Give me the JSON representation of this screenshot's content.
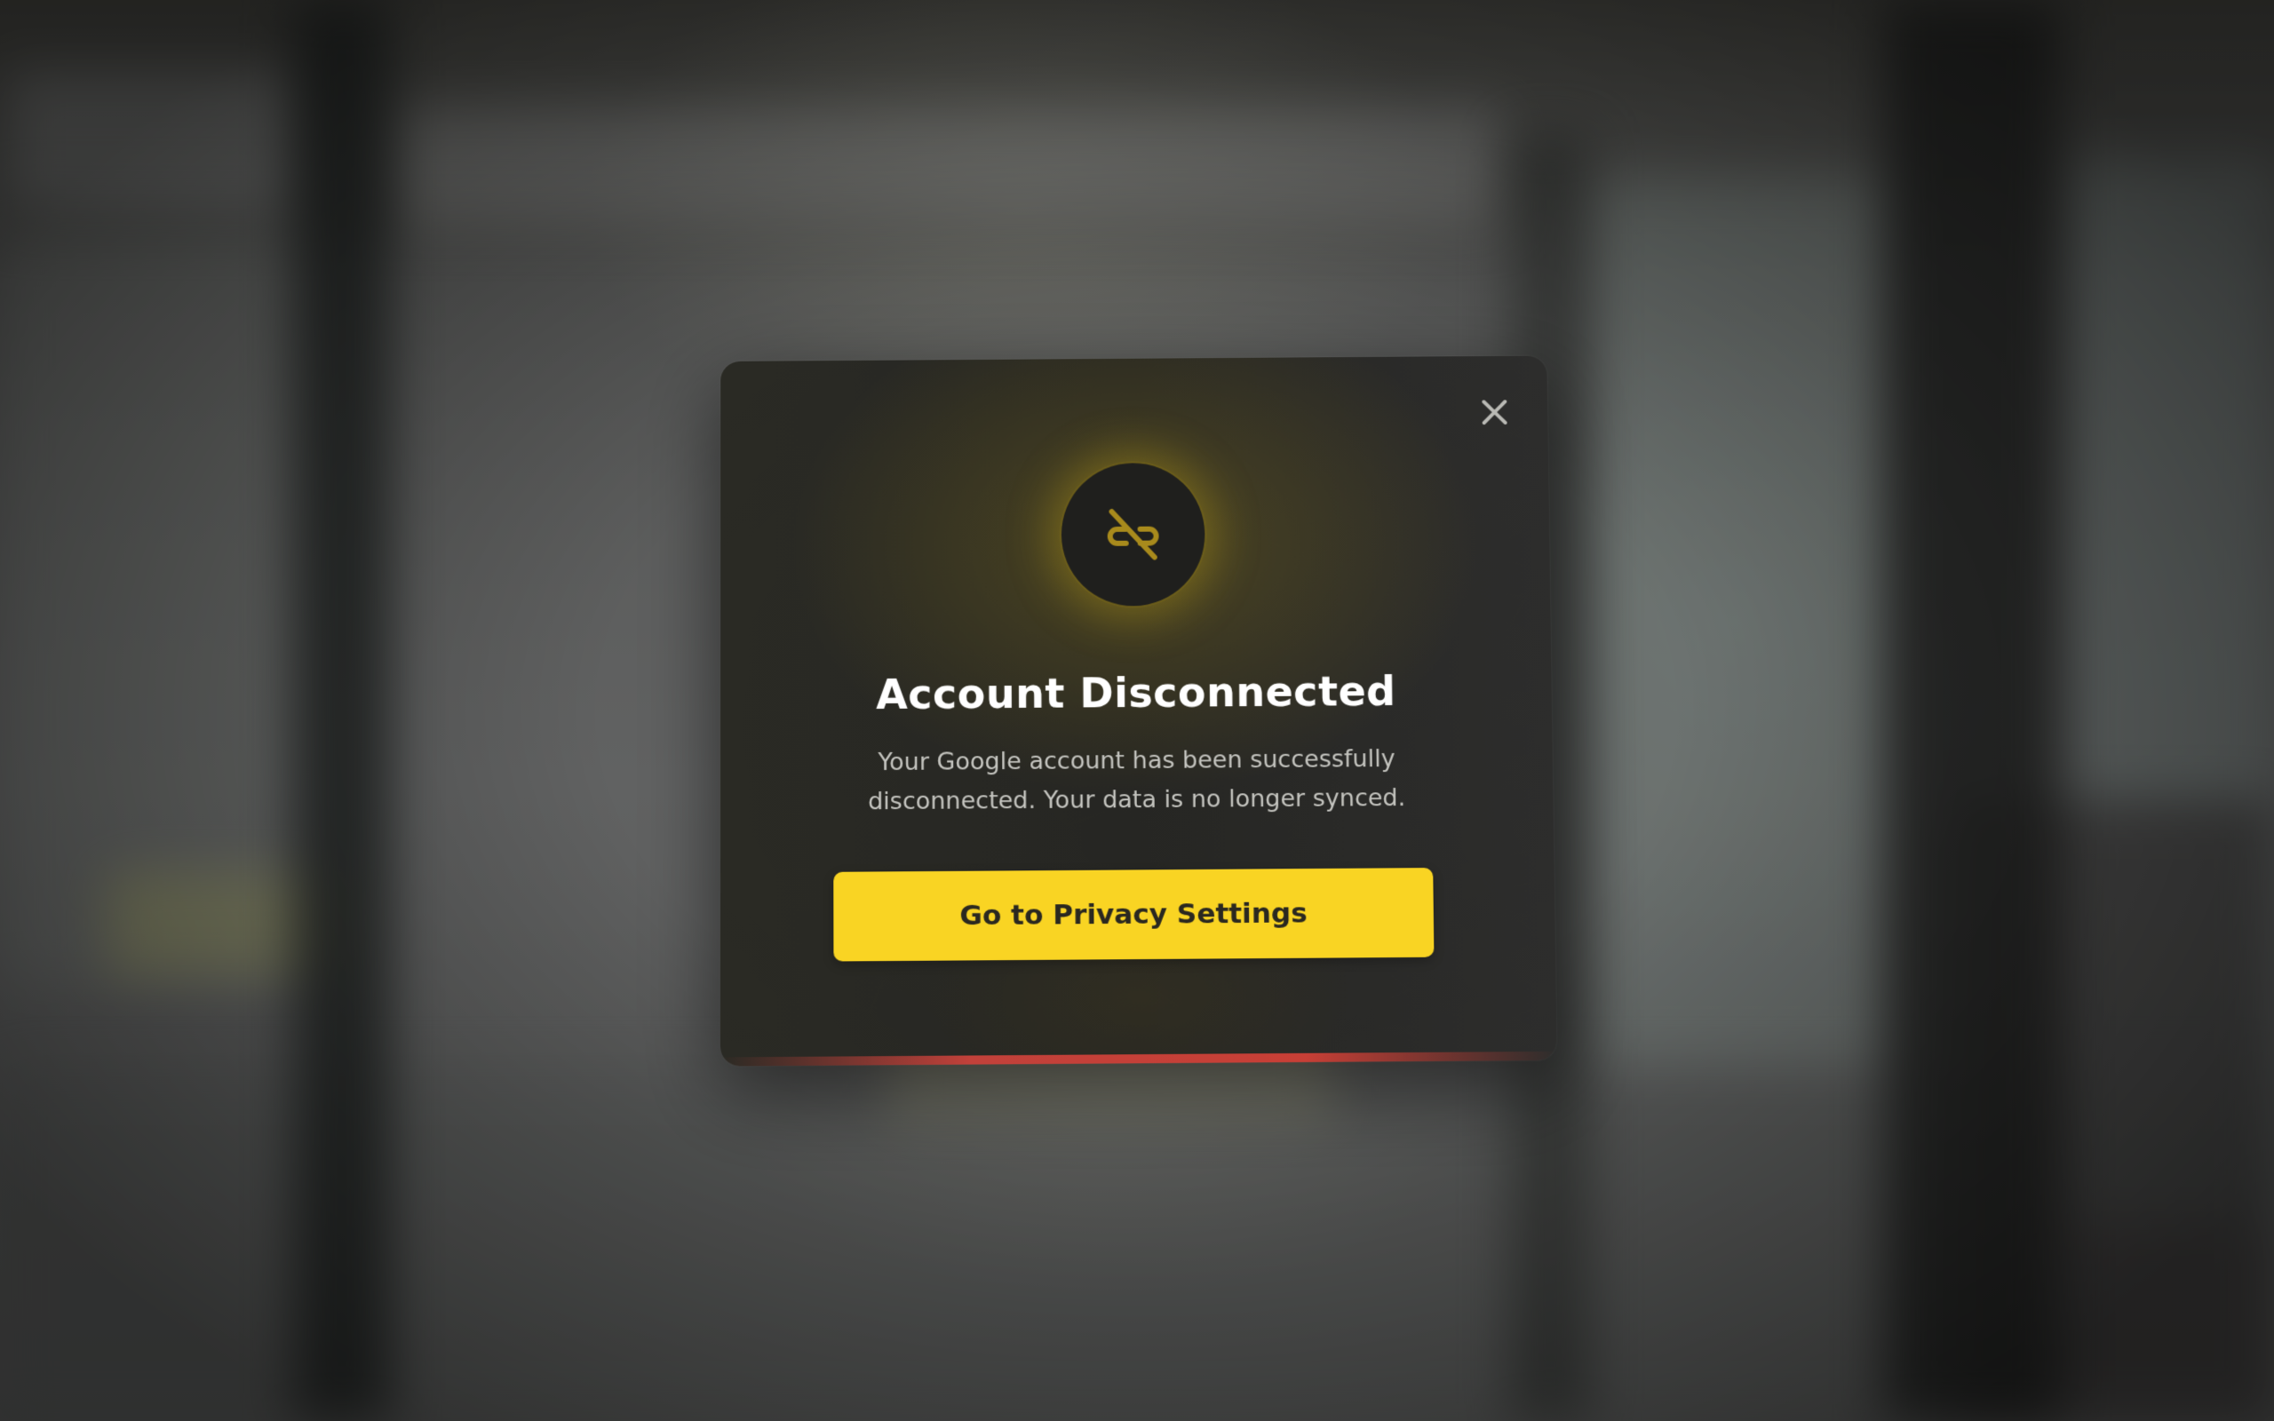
{
  "modal": {
    "title": "Account Disconnected",
    "message": "Your Google account has been successfully disconnected. Your data is no longer synced.",
    "primary_button_label": "Go to Privacy Settings",
    "close_icon": "close-icon",
    "status_icon": "link-broken-icon"
  },
  "colors": {
    "accent_yellow": "#f9d423",
    "modal_background": "#262623",
    "accent_red": "#c83f36",
    "title_text": "#ffffff",
    "body_text": "#c4c4bf"
  }
}
